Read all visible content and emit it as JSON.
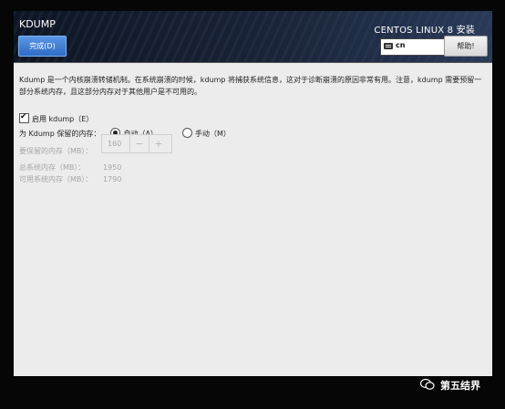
{
  "header": {
    "title": "KDUMP",
    "done_label": "完成(D)",
    "install_title": "CENTOS LINUX 8 安装",
    "keyboard_layout": "cn",
    "help_label": "帮助!"
  },
  "main": {
    "description": "Kdump 是一个内核崩溃转储机制。在系统崩溃的时候，kdump 将捕获系统信息，这对于诊断崩溃的原因非常有用。注意，kdump 需要预留一部分系统内存，且这部分内存对于其他用户是不可用的。",
    "enable_kdump": {
      "label": "启用 kdump（E）",
      "checked": true
    },
    "reserve_label": "为 Kdump 保留的内存：",
    "reserve_options": [
      {
        "label": "自动（A）",
        "selected": true
      },
      {
        "label": "手动（M）",
        "selected": false
      }
    ],
    "reserved_memory": {
      "label": "要保留的内存（MB）：",
      "value": "160",
      "decrement": "−",
      "increment": "+"
    },
    "total_memory": {
      "label": "总系统内存（MB）：",
      "value": "1950"
    },
    "usable_memory": {
      "label": "可用系统内存（MB）：",
      "value": "1790"
    }
  },
  "watermark": {
    "text": "第五结界"
  },
  "icons": {
    "keyboard": "keyboard-icon",
    "watermark": "wechat-icon"
  }
}
